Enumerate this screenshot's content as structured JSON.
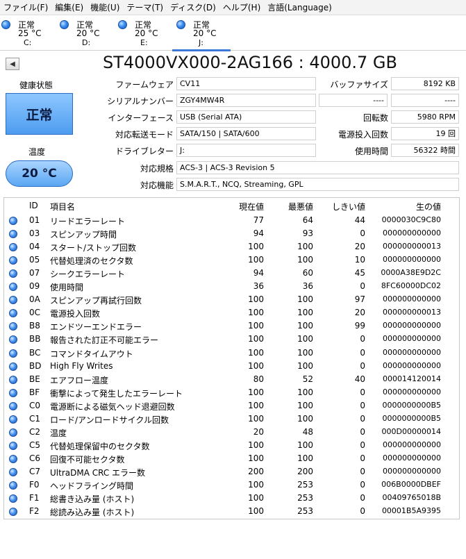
{
  "menu": [
    "ファイル(F)",
    "編集(E)",
    "機能(U)",
    "テーマ(T)",
    "ディスク(D)",
    "ヘルプ(H)",
    "言語(Language)"
  ],
  "drives": [
    {
      "status": "正常",
      "temp": "25 °C",
      "letter": "C:"
    },
    {
      "status": "正常",
      "temp": "20 °C",
      "letter": "D:"
    },
    {
      "status": "正常",
      "temp": "20 °C",
      "letter": "E:"
    },
    {
      "status": "正常",
      "temp": "20 °C",
      "letter": "J:"
    }
  ],
  "title": "ST4000VX000-2AG166 : 4000.7 GB",
  "health": {
    "label": "健康状態",
    "value": "正常"
  },
  "temperature": {
    "label": "温度",
    "value": "20 °C"
  },
  "info": {
    "firmware_label": "ファームウェア",
    "firmware": "CV11",
    "serial_label": "シリアルナンバー",
    "serial": "ZGY4MW4R",
    "interface_label": "インターフェース",
    "interface": "USB (Serial ATA)",
    "transfer_label": "対応転送モード",
    "transfer": "SATA/150 | SATA/600",
    "letter_label": "ドライブレター",
    "letter": "J:",
    "standard_label": "対応規格",
    "standard": "ACS-3 | ACS-3 Revision 5",
    "features_label": "対応機能",
    "features": "S.M.A.R.T., NCQ, Streaming, GPL",
    "buffer_label": "バッファサイズ",
    "buffer": "8192 KB",
    "blank1_label": "",
    "blank1": "----",
    "blank2": "----",
    "rotation_label": "回転数",
    "rotation": "5980 RPM",
    "power_count_label": "電源投入回数",
    "power_count": "19 回",
    "power_hours_label": "使用時間",
    "power_hours": "56322 時間"
  },
  "table": {
    "headers": {
      "id": "ID",
      "name": "項目名",
      "current": "現在値",
      "worst": "最悪値",
      "threshold": "しきい値",
      "raw": "生の値"
    },
    "rows": [
      {
        "id": "01",
        "name": "リードエラーレート",
        "current": "77",
        "worst": "64",
        "threshold": "44",
        "raw": "0000030C9C80"
      },
      {
        "id": "03",
        "name": "スピンアップ時間",
        "current": "94",
        "worst": "93",
        "threshold": "0",
        "raw": "000000000000"
      },
      {
        "id": "04",
        "name": "スタート/ストップ回数",
        "current": "100",
        "worst": "100",
        "threshold": "20",
        "raw": "000000000013"
      },
      {
        "id": "05",
        "name": "代替処理済のセクタ数",
        "current": "100",
        "worst": "100",
        "threshold": "10",
        "raw": "000000000000"
      },
      {
        "id": "07",
        "name": "シークエラーレート",
        "current": "94",
        "worst": "60",
        "threshold": "45",
        "raw": "0000A38E9D2C"
      },
      {
        "id": "09",
        "name": "使用時間",
        "current": "36",
        "worst": "36",
        "threshold": "0",
        "raw": "8FC60000DC02"
      },
      {
        "id": "0A",
        "name": "スピンアップ再試行回数",
        "current": "100",
        "worst": "100",
        "threshold": "97",
        "raw": "000000000000"
      },
      {
        "id": "0C",
        "name": "電源投入回数",
        "current": "100",
        "worst": "100",
        "threshold": "20",
        "raw": "000000000013"
      },
      {
        "id": "B8",
        "name": "エンドツーエンドエラー",
        "current": "100",
        "worst": "100",
        "threshold": "99",
        "raw": "000000000000"
      },
      {
        "id": "BB",
        "name": "報告された訂正不可能エラー",
        "current": "100",
        "worst": "100",
        "threshold": "0",
        "raw": "000000000000"
      },
      {
        "id": "BC",
        "name": "コマンドタイムアウト",
        "current": "100",
        "worst": "100",
        "threshold": "0",
        "raw": "000000000000"
      },
      {
        "id": "BD",
        "name": "High Fly Writes",
        "current": "100",
        "worst": "100",
        "threshold": "0",
        "raw": "000000000000"
      },
      {
        "id": "BE",
        "name": "エアフロー温度",
        "current": "80",
        "worst": "52",
        "threshold": "40",
        "raw": "000014120014"
      },
      {
        "id": "BF",
        "name": "衝撃によって発生したエラーレート",
        "current": "100",
        "worst": "100",
        "threshold": "0",
        "raw": "000000000000"
      },
      {
        "id": "C0",
        "name": "電源断による磁気ヘッド退避回数",
        "current": "100",
        "worst": "100",
        "threshold": "0",
        "raw": "0000000000B5"
      },
      {
        "id": "C1",
        "name": "ロード/アンロードサイクル回数",
        "current": "100",
        "worst": "100",
        "threshold": "0",
        "raw": "0000000000B5"
      },
      {
        "id": "C2",
        "name": "温度",
        "current": "20",
        "worst": "48",
        "threshold": "0",
        "raw": "000D00000014"
      },
      {
        "id": "C5",
        "name": "代替処理保留中のセクタ数",
        "current": "100",
        "worst": "100",
        "threshold": "0",
        "raw": "000000000000"
      },
      {
        "id": "C6",
        "name": "回復不可能セクタ数",
        "current": "100",
        "worst": "100",
        "threshold": "0",
        "raw": "000000000000"
      },
      {
        "id": "C7",
        "name": "UltraDMA CRC エラー数",
        "current": "200",
        "worst": "200",
        "threshold": "0",
        "raw": "000000000000"
      },
      {
        "id": "F0",
        "name": "ヘッドフライング時間",
        "current": "100",
        "worst": "253",
        "threshold": "0",
        "raw": "006B0000DBEF"
      },
      {
        "id": "F1",
        "name": "総書き込み量 (ホスト)",
        "current": "100",
        "worst": "253",
        "threshold": "0",
        "raw": "00409765018B"
      },
      {
        "id": "F2",
        "name": "総読み込み量 (ホスト)",
        "current": "100",
        "worst": "253",
        "threshold": "0",
        "raw": "00001B5A9395"
      }
    ]
  }
}
